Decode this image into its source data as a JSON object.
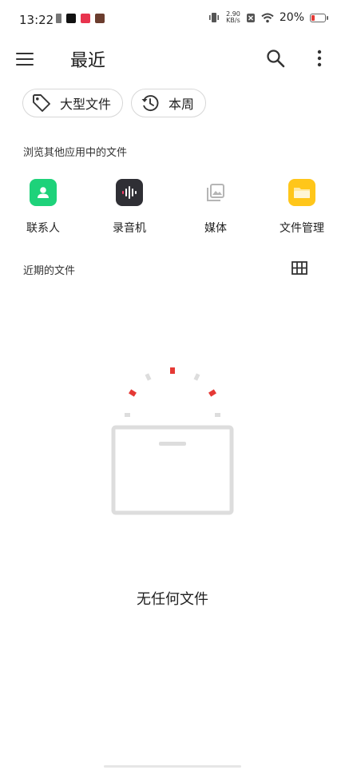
{
  "status_bar": {
    "time": "13:22",
    "net_speed_value": "2.90",
    "net_speed_unit": "KB/s",
    "battery_percent": "20%",
    "battery_level": 0.2
  },
  "app_bar": {
    "title": "最近",
    "icons": [
      "menu-icon",
      "search-icon",
      "more-vert-icon"
    ]
  },
  "chips": [
    {
      "label": "大型文件",
      "icon": "tag-icon"
    },
    {
      "label": "本周",
      "icon": "history-icon"
    }
  ],
  "browse_section": {
    "title": "浏览其他应用中的文件"
  },
  "apps": [
    {
      "label": "联系人",
      "icon": "contact-icon",
      "color": "#1ED27A"
    },
    {
      "label": "录音机",
      "icon": "recorder-icon",
      "color": "#2F2F35"
    },
    {
      "label": "媒体",
      "icon": "media-icon",
      "color": "#B5B5B5"
    },
    {
      "label": "文件管理",
      "icon": "folder-icon",
      "color": "#FFC61A"
    }
  ],
  "recent_section": {
    "title": "近期的文件",
    "view_icon": "grid-view-icon"
  },
  "empty_state": {
    "text": "无任何文件"
  },
  "colors": {
    "accent_red": "#E53935",
    "divider_gray": "#DDDDDD"
  }
}
